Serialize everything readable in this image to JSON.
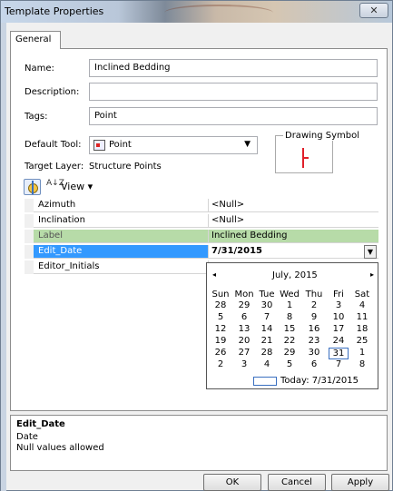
{
  "window": {
    "title": "Template Properties",
    "close_glyph": "✕"
  },
  "tabs": [
    {
      "label": "General"
    }
  ],
  "form": {
    "name_label": "Name:",
    "name_value": "Inclined Bedding",
    "description_label": "Description:",
    "description_value": "",
    "tags_label": "Tags:",
    "tags_value": "Point",
    "default_tool_label": "Default Tool:",
    "default_tool_value": "Point",
    "default_tool_icon": "point-tool-icon",
    "target_layer_label": "Target Layer:",
    "target_layer_value": "Structure Points",
    "drawing_symbol_label": "Drawing Symbol",
    "drawing_symbol_color": "#e0202a"
  },
  "toolbar": {
    "view_label": "View",
    "view_arrow": "▾",
    "sort_glyph": "A↓Z"
  },
  "properties": [
    {
      "name": "Azimuth",
      "value": "<Null>"
    },
    {
      "name": "Inclination",
      "value": "<Null>"
    },
    {
      "name": "Label",
      "value": "Inclined Bedding"
    },
    {
      "name": "Edit_Date",
      "value": "7/31/2015"
    },
    {
      "name": "Editor_Initials",
      "value": ""
    }
  ],
  "calendar": {
    "prev": "◂",
    "next": "▸",
    "title": "July, 2015",
    "day_headers": [
      "Sun",
      "Mon",
      "Tue",
      "Wed",
      "Thu",
      "Fri",
      "Sat"
    ],
    "weeks": [
      [
        "28",
        "29",
        "30",
        "1",
        "2",
        "3",
        "4"
      ],
      [
        "5",
        "6",
        "7",
        "8",
        "9",
        "10",
        "11"
      ],
      [
        "12",
        "13",
        "14",
        "15",
        "16",
        "17",
        "18"
      ],
      [
        "19",
        "20",
        "21",
        "22",
        "23",
        "24",
        "25"
      ],
      [
        "26",
        "27",
        "28",
        "29",
        "30",
        "31",
        "1"
      ],
      [
        "2",
        "3",
        "4",
        "5",
        "6",
        "7",
        "8"
      ]
    ],
    "selected_day": "31",
    "today_label": "Today: 7/31/2015"
  },
  "description_box": {
    "title": "Edit_Date",
    "line1": "Date",
    "line2": "Null values allowed"
  },
  "buttons": {
    "ok": "OK",
    "cancel": "Cancel",
    "apply": "Apply"
  },
  "colors": {
    "selection": "#3399ff",
    "label_row": "#b7dba8"
  }
}
